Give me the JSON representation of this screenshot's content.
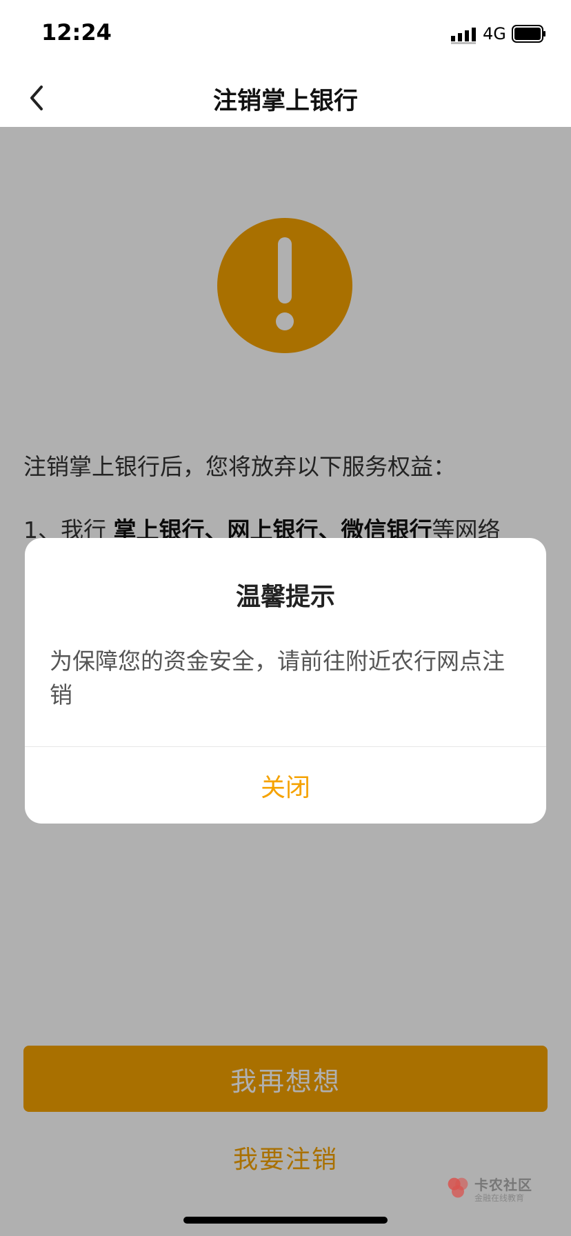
{
  "status_bar": {
    "time": "12:24",
    "network": "4G"
  },
  "nav": {
    "title": "注销掌上银行"
  },
  "page": {
    "intro": "注销掌上银行后，您将放弃以下服务权益：",
    "item1": {
      "prefix": "1、我行",
      "highlight": "掌上银行、网上银行、微信银行",
      "suffix": "等网络"
    },
    "primary_button": "我再想想",
    "secondary_link": "我要注销"
  },
  "dialog": {
    "title": "温馨提示",
    "message": "为保障您的资金安全，请前往附近农行网点注销",
    "close_button": "关闭"
  },
  "watermark": {
    "main": "卡农社区",
    "sub": "金融在线教育"
  },
  "colors": {
    "accent": "#f5a200",
    "overlay": "rgba(0,0,0,0.31)"
  },
  "icons": [
    "signal-icon",
    "battery-icon",
    "back-arrow-icon",
    "warning-icon",
    "watermark-logo-icon"
  ]
}
